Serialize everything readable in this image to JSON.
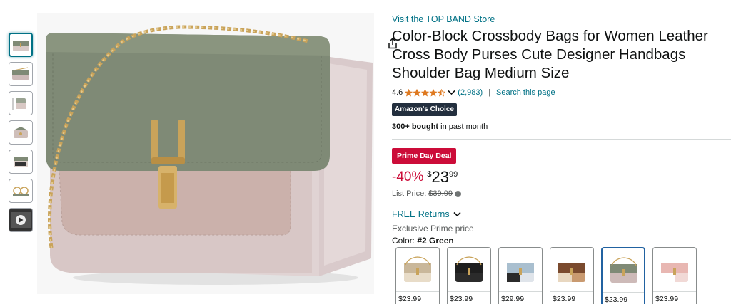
{
  "thumbnails": [
    {
      "name": "thumb-green-bag",
      "active": true
    },
    {
      "name": "thumb-bag-side"
    },
    {
      "name": "thumb-bag-size"
    },
    {
      "name": "thumb-bag-open"
    },
    {
      "name": "thumb-bag-detail"
    },
    {
      "name": "thumb-bag-chain"
    },
    {
      "name": "thumb-video",
      "video": true
    }
  ],
  "product": {
    "store_link": "Visit the TOP BAND Store",
    "title": "Color-Block Crossbody Bags for Women Leather Cross Body Purses Cute Designer Handbags Shoulder Bag Medium Size",
    "rating_value": "4.6",
    "stars_filled": 4.5,
    "rating_count": "(2,983)",
    "search_link": "Search this page",
    "choice_badge": "Amazon's Choice",
    "bought_bold": "300+ bought",
    "bought_rest": " in past month",
    "deal_badge": "Prime Day Deal",
    "discount": "-40%",
    "currency_symbol": "$",
    "price_whole": "23",
    "price_fraction": "99",
    "list_price_label": "List Price:",
    "list_price": "$39.99",
    "returns": "FREE Returns",
    "exclusive": "Exclusive Prime price",
    "color_label": "Color: ",
    "color_value": "#2 Green"
  },
  "swatches": [
    {
      "price": "$23.99",
      "flap": "#c9b79a",
      "body": "#e8dcc8"
    },
    {
      "price": "$23.99",
      "flap": "#1e1e1e",
      "body": "#2b2b2b"
    },
    {
      "price": "$29.99",
      "flap": "#a9bfcf",
      "body": "#dfe4ea"
    },
    {
      "price": "$23.99",
      "flap": "#7a4a2e",
      "body": "#c99a70"
    },
    {
      "price": "$23.99",
      "flap": "#7f8a76",
      "body": "#cdbab8",
      "selected": true
    },
    {
      "price": "$23.99",
      "flap": "#e8b7b2",
      "body": "#f1d9d6"
    }
  ],
  "colors": {
    "link": "#007185",
    "deal": "#cc0c39",
    "badge_dark": "#232f3e",
    "star": "#de7921"
  }
}
